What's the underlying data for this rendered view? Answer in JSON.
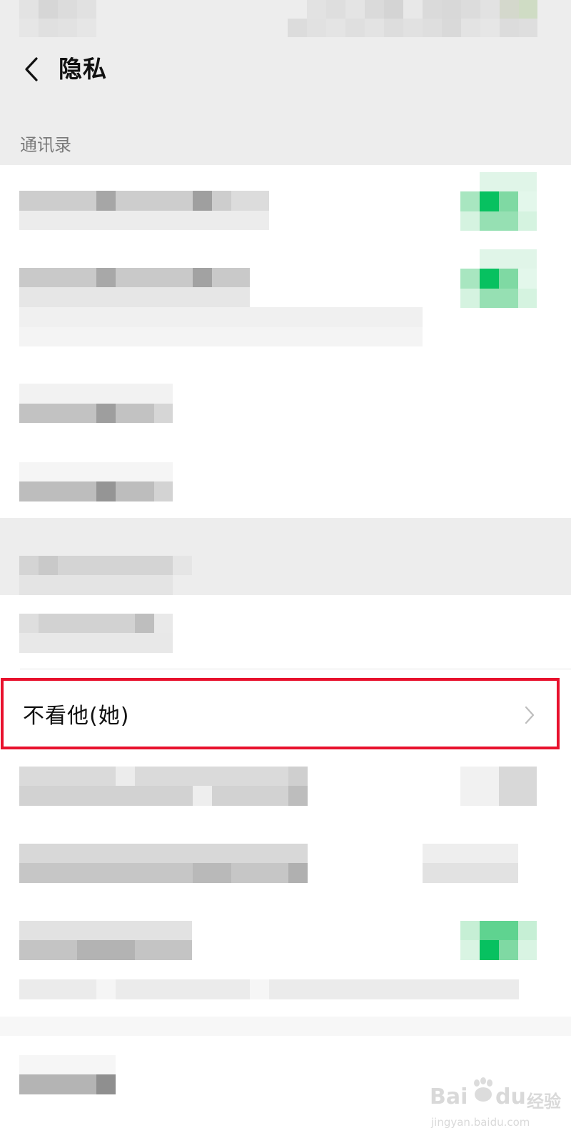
{
  "nav": {
    "title": "隐私",
    "back_icon": "chevron-left-icon"
  },
  "section": {
    "header": "通讯录"
  },
  "highlighted_row": {
    "label": "不看他(她)",
    "icon": "chevron-right-icon"
  },
  "watermark": {
    "brand": "Bai",
    "brand_2": "du",
    "suffix": "经验",
    "url": "jingyan.baidu.com"
  },
  "colors": {
    "accent_green": "#07c160",
    "highlight_border": "#e8112d",
    "page_background": "#ededed"
  }
}
